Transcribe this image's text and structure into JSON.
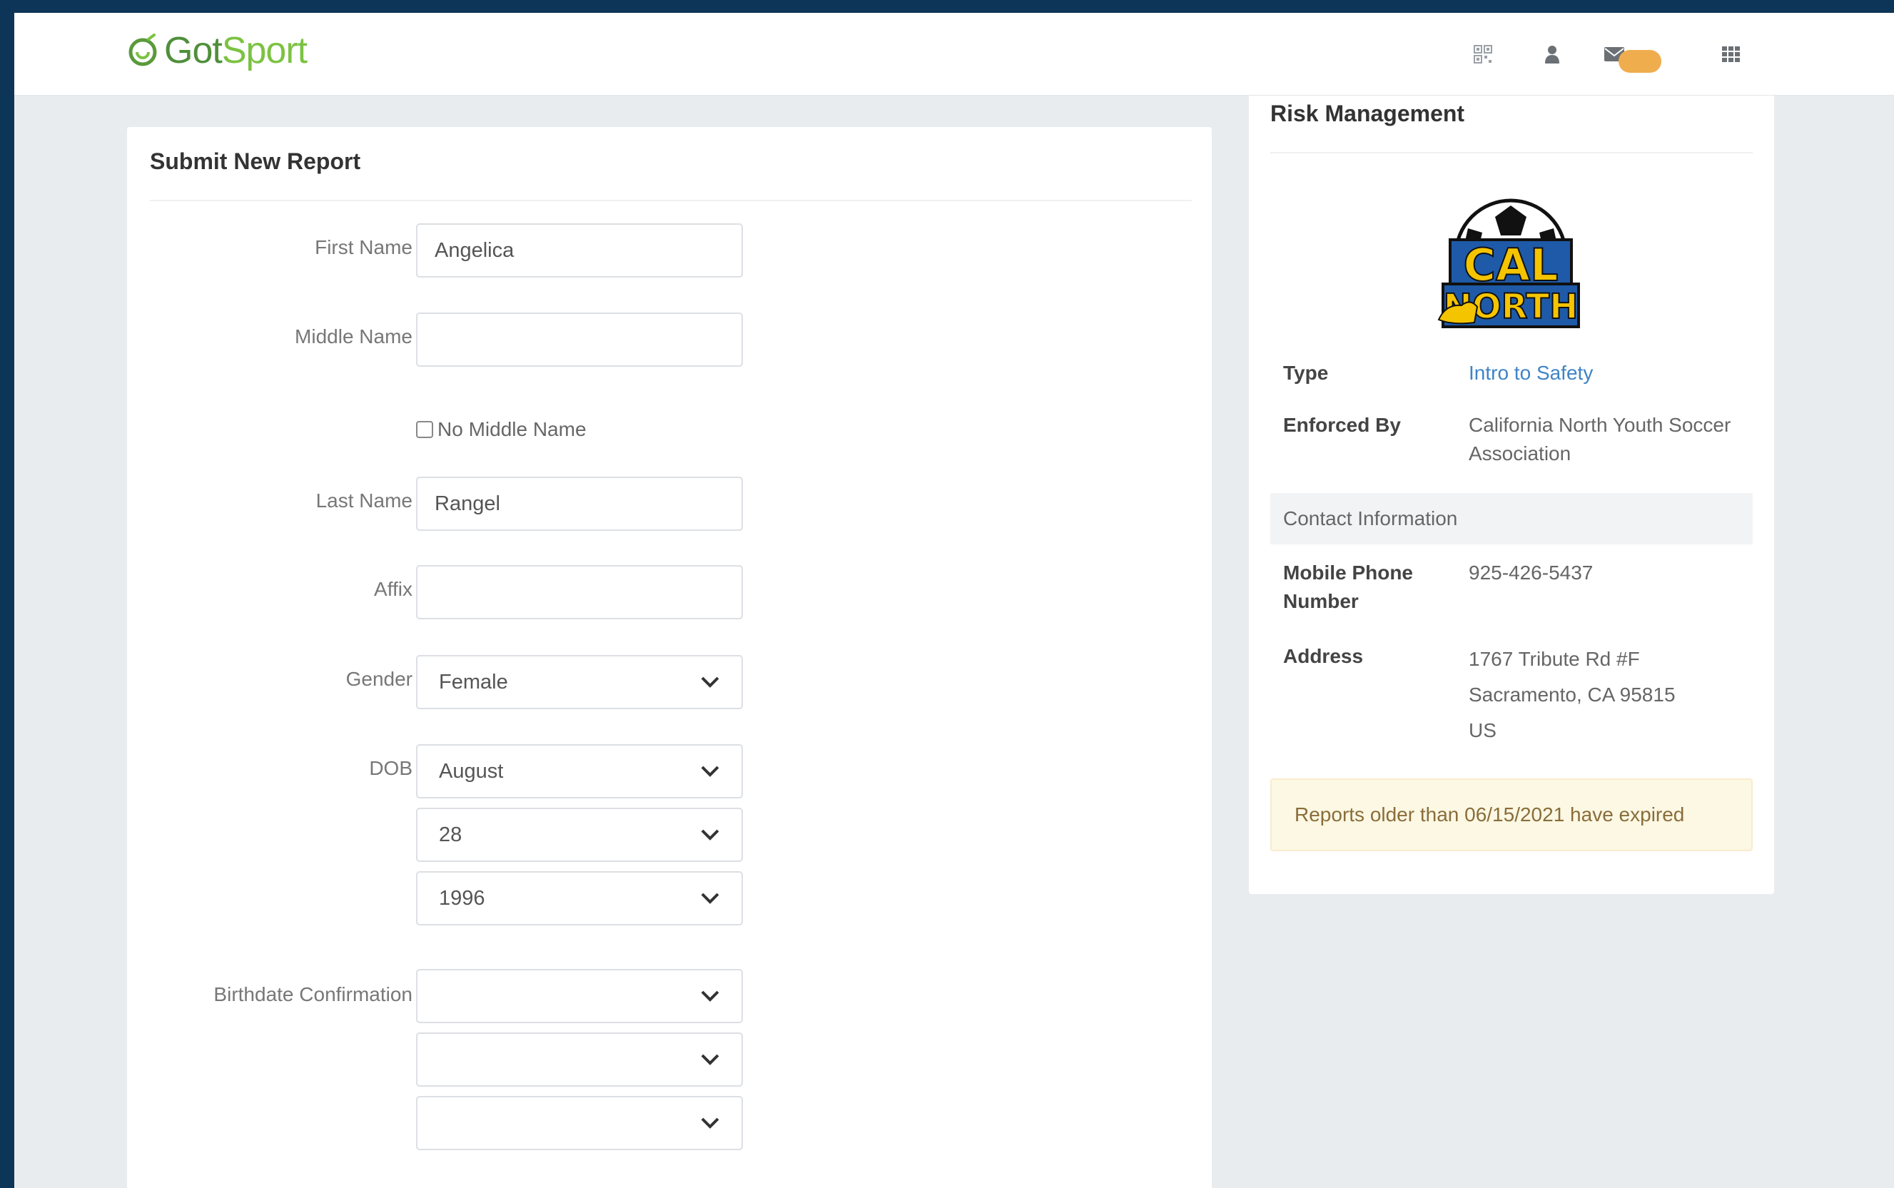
{
  "brand": {
    "logo_got": "Got",
    "logo_sport": "Sport"
  },
  "header": {
    "mail_badge_count": "",
    "icons": [
      "qrcode-icon",
      "user-icon",
      "envelope-icon",
      "apps-grid-icon"
    ]
  },
  "form": {
    "title": "Submit New Report",
    "first_name_label": "First Name",
    "first_name_value": "Angelica",
    "middle_name_label": "Middle Name",
    "middle_name_value": "",
    "no_middle_name_label": "No Middle Name",
    "last_name_label": "Last Name",
    "last_name_value": "Rangel",
    "affix_label": "Affix",
    "affix_value": "",
    "gender_label": "Gender",
    "gender_value": "Female",
    "dob_label": "DOB",
    "dob_month": "August",
    "dob_day": "28",
    "dob_year": "1996",
    "birthdate_confirmation_label": "Birthdate Confirmation",
    "confirm_month": "",
    "confirm_day": "",
    "confirm_year": ""
  },
  "risk": {
    "title": "Risk Management",
    "logo_text_top": "CAL",
    "logo_text_bottom": "NORTH",
    "type_label": "Type",
    "type_value": "Intro to Safety",
    "enforced_label": "Enforced By",
    "enforced_value": "California North Youth Soccer Association",
    "contact_heading": "Contact Information",
    "phone_label": "Mobile Phone Number",
    "phone_value": "925-426-5437",
    "address_label": "Address",
    "address_line1": "1767 Tribute Rd #F",
    "address_line2": "Sacramento, CA 95815",
    "address_line3": "US",
    "alert_text": "Reports older than 06/15/2021 have expired"
  },
  "colors": {
    "frame": "#0d3557",
    "page_bg": "#e9ecef",
    "brand_green": "#7cc242",
    "link_blue": "#3f84c6",
    "badge_orange": "#f0ad4e",
    "alert_bg": "#fcf8e3"
  }
}
